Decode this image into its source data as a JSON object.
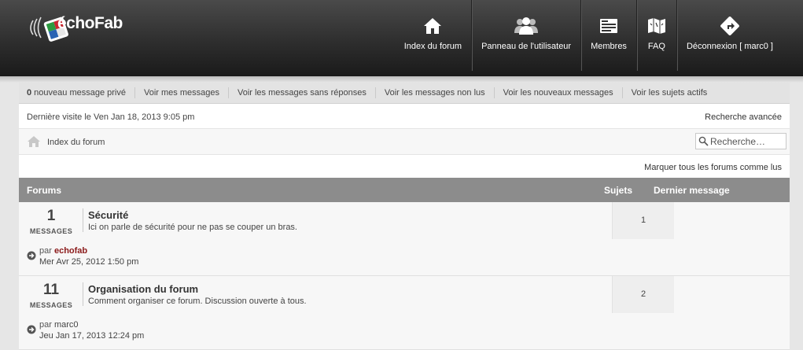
{
  "header": {
    "logo_text": "échoFab",
    "nav": [
      {
        "label": "Index du forum",
        "icon": "home-icon"
      },
      {
        "label": "Panneau de l'utilisateur",
        "icon": "users-icon"
      },
      {
        "label": "Membres",
        "icon": "members-icon"
      },
      {
        "label": "FAQ",
        "icon": "map-icon"
      },
      {
        "label": "Déconnexion [ marc0 ]",
        "icon": "logout-icon"
      }
    ]
  },
  "subbar": {
    "private_count": "0",
    "private_label": " nouveau message privé",
    "links": [
      "Voir mes messages",
      "Voir les messages sans réponses",
      "Voir les messages non lus",
      "Voir les nouveaux messages",
      "Voir les sujets actifs"
    ]
  },
  "info": {
    "last_visit": "Dernière visite le Ven Jan 18, 2013 9:05 pm",
    "advanced_search": "Recherche avancée"
  },
  "breadcrumb": {
    "label": "Index du forum",
    "search_placeholder": "Recherche…"
  },
  "mark_read": "Marquer tous les forums comme lus",
  "table": {
    "col_forums": "Forums",
    "col_topics": "Sujets",
    "col_last": "Dernier message"
  },
  "forums": [
    {
      "count": "1",
      "count_label": "MESSAGES",
      "title": "Sécurité",
      "description": "Ici on parle de sécurité pour ne pas se couper un bras.",
      "topics": "1",
      "by_prefix": "par ",
      "author": "echofab",
      "date": "Mer Avr 25, 2012 1:50 pm"
    },
    {
      "count": "11",
      "count_label": "MESSAGES",
      "title": "Organisation du forum",
      "description": "Comment organiser ce forum. Discussion ouverte à tous.",
      "topics": "2",
      "by_prefix": "par ",
      "author": "marc0",
      "date": "Jeu Jan 17, 2013 12:24 pm"
    }
  ],
  "colors": {
    "header": "#2e2e2e",
    "table_head": "#8c8c8c",
    "author_accent": "#8b1a1a"
  }
}
